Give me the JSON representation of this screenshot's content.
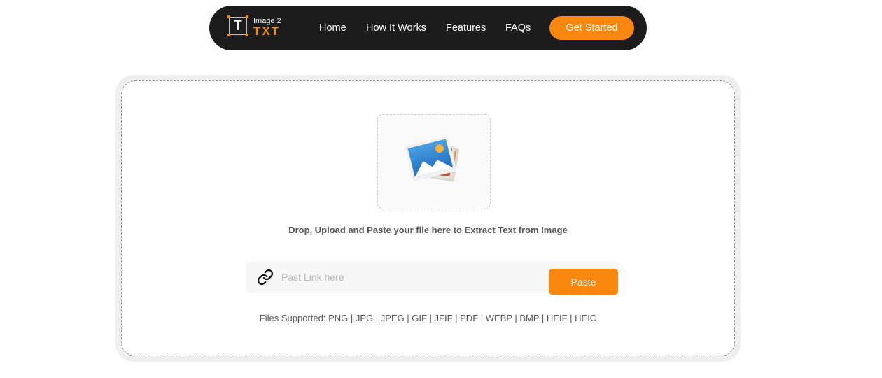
{
  "nav": {
    "logo_small": "Image 2",
    "logo_big": "TXT",
    "logo_letter": "T",
    "links": [
      "Home",
      "How It Works",
      "Features",
      "FAQs"
    ],
    "cta": "Get Started"
  },
  "upload": {
    "drop_text": "Drop, Upload and Paste your file here to Extract Text from Image",
    "link_placeholder": "Past Link here",
    "paste_label": "Paste",
    "files_supported": "Files Supported: PNG | JPG | JPEG | GIF | JFIF | PDF | WEBP | BMP | HEIF | HEIC"
  },
  "colors": {
    "accent": "#f7870f",
    "nav_bg": "#1c1c1c"
  },
  "icons": [
    "image-gallery-icon",
    "link-icon"
  ]
}
